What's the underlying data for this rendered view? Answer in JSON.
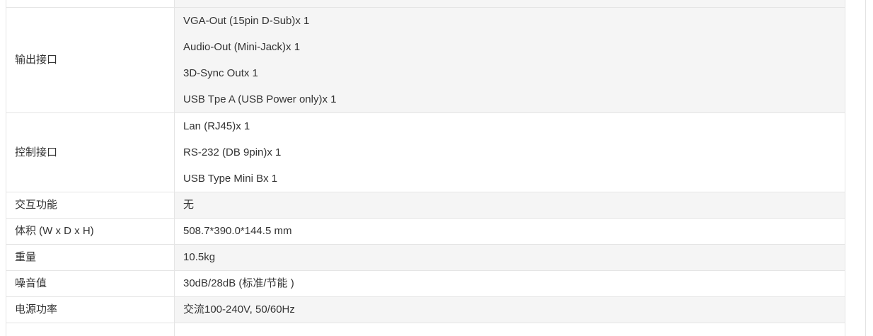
{
  "spec_rows": [
    {
      "label": "输出接口",
      "values": [
        "VGA-Out (15pin D-Sub)x 1",
        "Audio-Out (Mini-Jack)x 1",
        "3D-Sync Outx 1",
        "USB Tpe A (USB Power only)x 1"
      ]
    },
    {
      "label": "控制接口",
      "values": [
        "Lan (RJ45)x 1",
        "RS-232 (DB 9pin)x 1",
        "USB Type Mini Bx 1"
      ]
    },
    {
      "label": "交互功能",
      "value": "无"
    },
    {
      "label": "体积 (W x D x H)",
      "value": "508.7*390.0*144.5 mm"
    },
    {
      "label": "重量",
      "value": "10.5kg"
    },
    {
      "label": "噪音值",
      "value": "30dB/28dB (标准/节能 )"
    },
    {
      "label": "电源功率",
      "value": "交流100-240V, 50/60Hz"
    }
  ]
}
